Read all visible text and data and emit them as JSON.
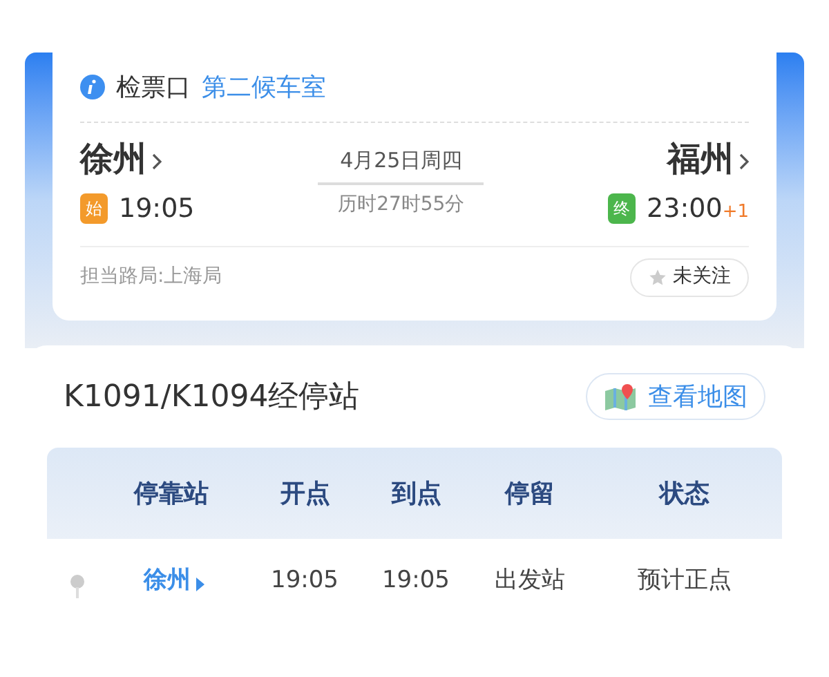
{
  "ticket_card": {
    "gate_label": "检票口",
    "gate_value": "第二候车室",
    "from": {
      "station": "徐州",
      "badge": "始",
      "time": "19:05"
    },
    "date": "4月25日周四",
    "duration": "历时27时55分",
    "to": {
      "station": "福州",
      "badge": "终",
      "time": "23:00",
      "day_offset": "+1"
    },
    "bureau": "担当路局:上海局",
    "follow": {
      "label": "未关注",
      "followed": false
    }
  },
  "stops": {
    "title": "K1091/K1094经停站",
    "map_button": "查看地图",
    "columns": [
      "停靠站",
      "开点",
      "到点",
      "停留",
      "状态"
    ],
    "rows": [
      {
        "station": "徐州",
        "depart": "19:05",
        "arrive": "19:05",
        "stay": "出发站",
        "status": "预计正点"
      }
    ]
  }
}
